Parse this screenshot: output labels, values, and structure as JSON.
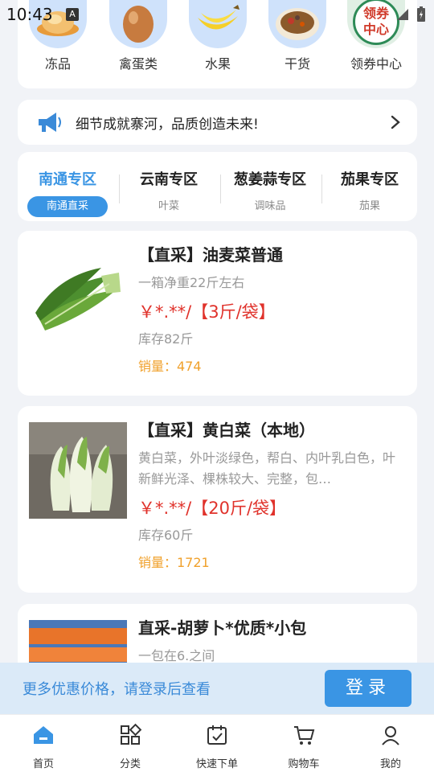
{
  "status": {
    "time": "10:43",
    "a_badge": "A"
  },
  "categories": [
    {
      "label": "冻品",
      "icon": "frozen-chicken-icon"
    },
    {
      "label": "禽蛋类",
      "icon": "egg-icon"
    },
    {
      "label": "水果",
      "icon": "banana-icon"
    },
    {
      "label": "干货",
      "icon": "dried-goods-icon"
    },
    {
      "label": "领券中心",
      "icon": "coupon-center-icon",
      "badge_text": "领券中心"
    }
  ],
  "notice": {
    "text": "细节成就寨河，品质创造未来!"
  },
  "zones": [
    {
      "title": "南通专区",
      "sub": "南通直采",
      "active": true
    },
    {
      "title": "云南专区",
      "sub": "叶菜"
    },
    {
      "title": "葱姜蒜专区",
      "sub": "调味品"
    },
    {
      "title": "茄果专区",
      "sub": "茄果"
    }
  ],
  "products": [
    {
      "name": "【直采】油麦菜普通",
      "desc": "一箱净重22斤左右",
      "price": "￥*.**/【3斤/袋】",
      "stock": "库存82斤",
      "sales": "销量：474"
    },
    {
      "name": "【直采】黄白菜（本地）",
      "desc": "黄白菜，外叶淡绿色，帮白、内叶乳白色，叶新鲜光泽、棵株较大、完整，包…",
      "price": "￥*.**/【20斤/袋】",
      "stock": "库存60斤",
      "sales": "销量：1721"
    },
    {
      "name": "直采-胡萝卜*优质*小包",
      "desc": "一包在6.之间"
    }
  ],
  "login_bar": {
    "text": "更多优惠价格，请登录后查看",
    "button": "登录"
  },
  "nav": [
    {
      "label": "首页",
      "icon": "home-icon",
      "active": true
    },
    {
      "label": "分类",
      "icon": "category-icon"
    },
    {
      "label": "快速下单",
      "icon": "quick-order-icon"
    },
    {
      "label": "购物车",
      "icon": "cart-icon"
    },
    {
      "label": "我的",
      "icon": "profile-icon"
    }
  ],
  "colors": {
    "accent": "#3a95e4",
    "price": "#e0322b",
    "sales": "#f0a12c"
  }
}
